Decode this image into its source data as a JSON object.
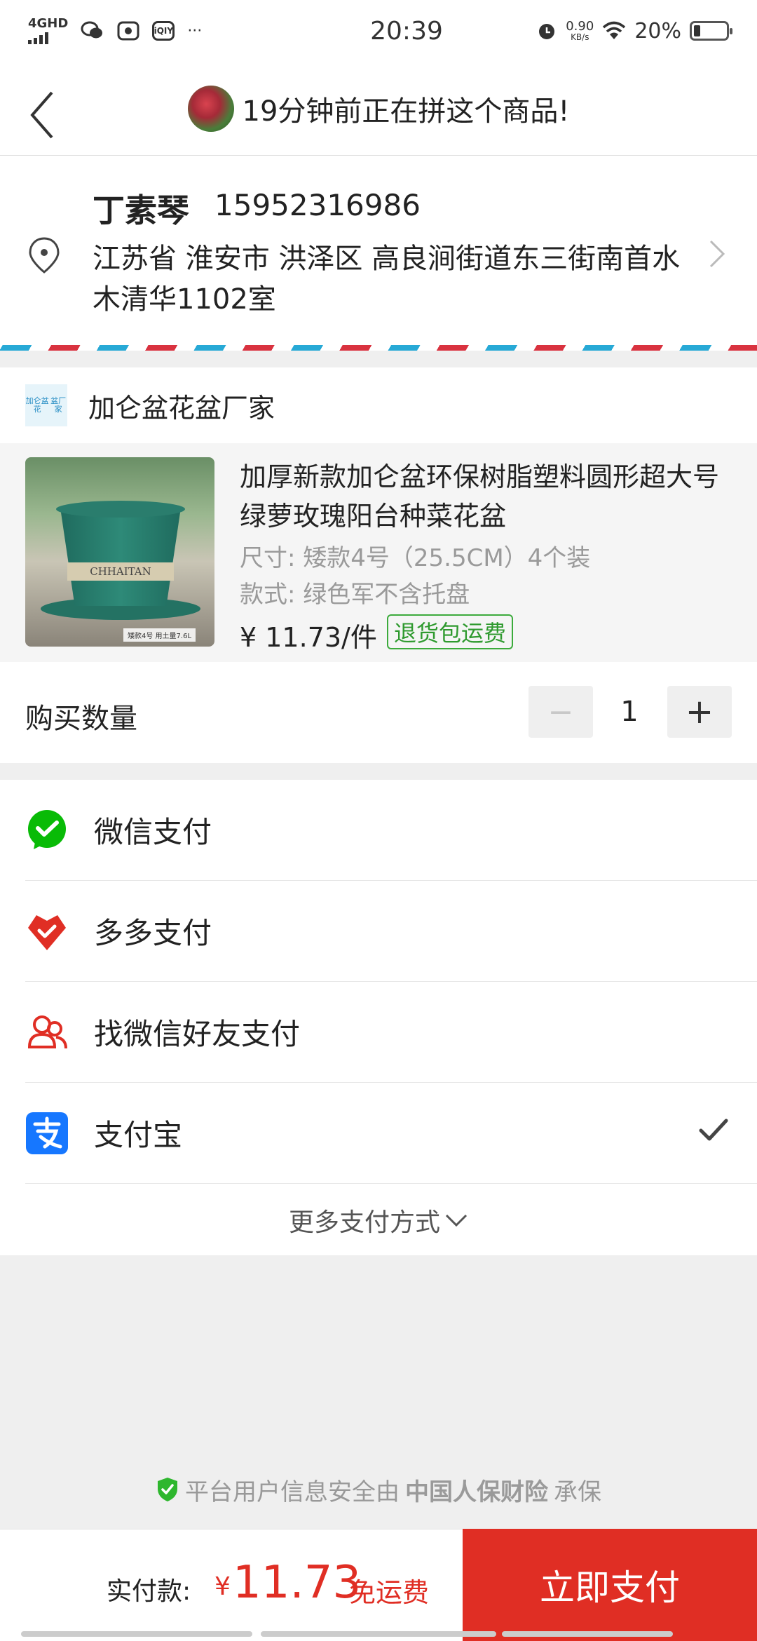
{
  "status_bar": {
    "network": "4GHD",
    "time": "20:39",
    "speed_value": "0.90",
    "speed_unit": "KB/s",
    "battery": "20%",
    "battery_level": 0.2,
    "app_icon_label": "iQIY",
    "more": "···"
  },
  "header": {
    "title": "19分钟前正在拼这个商品!"
  },
  "address": {
    "name": "丁素琴",
    "phone": "15952316986",
    "detail": "江苏省 淮安市 洪泽区 高良涧街道东三街南首水木清华1102室"
  },
  "shop": {
    "name": "加仑盆花盆厂家",
    "logo_text": "加仑盆花盆厂家"
  },
  "product": {
    "title": "加厚新款加仑盆环保树脂塑料圆形超大号绿萝玫瑰阳台种菜花盆",
    "spec": "尺寸: 矮款4号（25.5CM）4个装",
    "style": "款式: 绿色军不含托盘",
    "price": "¥ 11.73/件",
    "return_badge": "退货包运费",
    "image_label": "CHHAITAN",
    "image_tag": "矮款4号  用土量7.6L"
  },
  "quantity": {
    "label": "购买数量",
    "value": "1",
    "minus": "−",
    "plus": "+"
  },
  "payment": {
    "methods": [
      {
        "label": "微信支付",
        "icon": "wechat-pay-icon",
        "selected": false
      },
      {
        "label": "多多支付",
        "icon": "duoduo-pay-icon",
        "selected": false
      },
      {
        "label": "找微信好友支付",
        "icon": "friend-pay-icon",
        "selected": false
      },
      {
        "label": "支付宝",
        "icon": "alipay-icon",
        "selected": true
      }
    ],
    "more": "更多支付方式"
  },
  "footer": {
    "security_prefix": "平台用户信息安全由",
    "security_brand": "中国人保财险",
    "security_suffix": "承保",
    "total_label": "实付款:",
    "total_currency": "¥",
    "total_amount": "11.73",
    "free_shipping": "免运费",
    "pay_button": "立即支付"
  },
  "colors": {
    "accent_red": "#e02e24",
    "wechat_green": "#09bb07",
    "alipay_blue": "#1677ff",
    "badge_green": "#3cab3c"
  }
}
